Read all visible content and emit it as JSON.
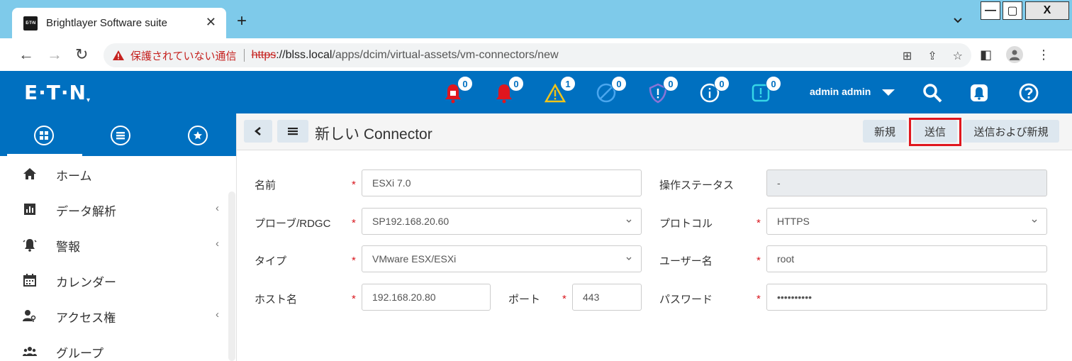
{
  "browser": {
    "tab_title": "Brightlayer Software suite",
    "tab_favicon_text": "E·T·N",
    "new_tab": "+",
    "close": "✕",
    "insecure_label": "保護されていない通信",
    "url_scheme": "https",
    "url_host": "://blss.local",
    "url_path": "/apps/dcim/virtual-assets/vm-connectors/new",
    "window_min": "—",
    "window_max": "▢",
    "window_close": "X"
  },
  "header": {
    "logo": "E·T·N",
    "badges": {
      "critical": "0",
      "alarm": "0",
      "warning": "1",
      "blocked": "0",
      "security": "0",
      "info": "0",
      "notice": "0"
    },
    "user": "admin admin"
  },
  "sidebar": {
    "items": [
      {
        "label": "ホーム",
        "icon": "home-icon",
        "has_submenu": false
      },
      {
        "label": "データ解析",
        "icon": "chart-icon",
        "has_submenu": true
      },
      {
        "label": "警報",
        "icon": "alarm-icon",
        "has_submenu": true
      },
      {
        "label": "カレンダー",
        "icon": "calendar-icon",
        "has_submenu": false
      },
      {
        "label": "アクセス権",
        "icon": "access-icon",
        "has_submenu": true
      },
      {
        "label": "グループ",
        "icon": "group-icon",
        "has_submenu": false
      }
    ]
  },
  "toolbar": {
    "title": "新しい Connector",
    "new_label": "新規",
    "submit_label": "送信",
    "submit_new_label": "送信および新規"
  },
  "form": {
    "name_label": "名前",
    "name_value": "ESXi 7.0",
    "status_label": "操作ステータス",
    "status_value": "-",
    "probe_label": "プローブ/RDGC",
    "probe_value": "SP192.168.20.60",
    "protocol_label": "プロトコル",
    "protocol_value": "HTTPS",
    "type_label": "タイプ",
    "type_value": "VMware ESX/ESXi",
    "user_label": "ユーザー名",
    "user_value": "root",
    "host_label": "ホスト名",
    "host_value": "192.168.20.80",
    "port_label": "ポート",
    "port_value": "443",
    "password_label": "パスワード",
    "password_value": "••••••••••",
    "required_mark": "*"
  },
  "colors": {
    "brand": "#0070c0",
    "highlight": "#e0161e",
    "critical": "#e0161e",
    "warning": "#f0c419",
    "security": "#6b4fbb"
  }
}
